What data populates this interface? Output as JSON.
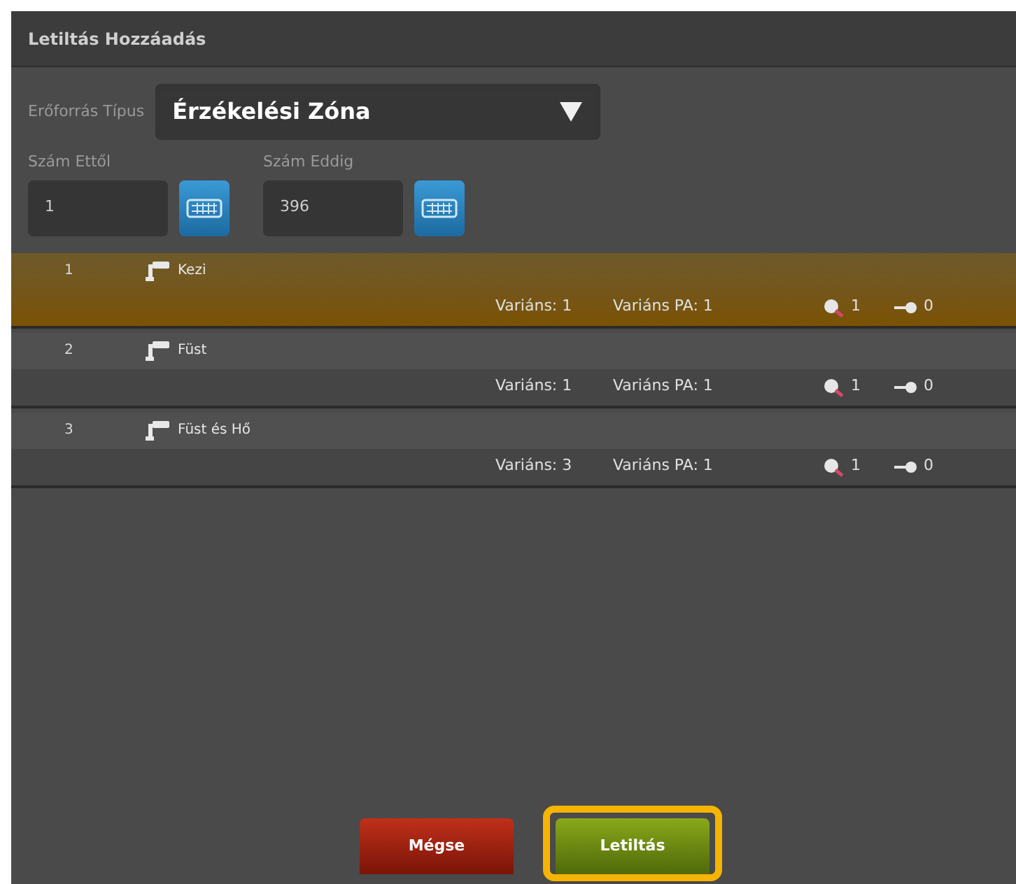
{
  "window": {
    "title": "Letiltás Hozzáadás"
  },
  "resource_type": {
    "label": "Erőforrás Típus",
    "value": "Érzékelési Zóna"
  },
  "range": [
    {
      "label": "Szám Ettől",
      "value": "1"
    },
    {
      "label": "Szám Eddig",
      "value": "396"
    }
  ],
  "rows": [
    {
      "number": "1",
      "name": "Kezi",
      "variant": "Variáns: 1",
      "variant_pa": "Variáns PA: 1",
      "count_a": "1",
      "count_b": "0",
      "selected": true
    },
    {
      "number": "2",
      "name": "Füst",
      "variant": "Variáns: 1",
      "variant_pa": "Variáns PA: 1",
      "count_a": "1",
      "count_b": "0",
      "selected": false
    },
    {
      "number": "3",
      "name": "Füst és Hő",
      "variant": "Variáns: 3",
      "variant_pa": "Variáns PA: 1",
      "count_a": "1",
      "count_b": "0",
      "selected": false
    }
  ],
  "buttons": [
    {
      "label": "Mégse",
      "kind": "cancel",
      "highlighted": false
    },
    {
      "label": "Letiltás",
      "kind": "confirm",
      "highlighted": true
    }
  ]
}
